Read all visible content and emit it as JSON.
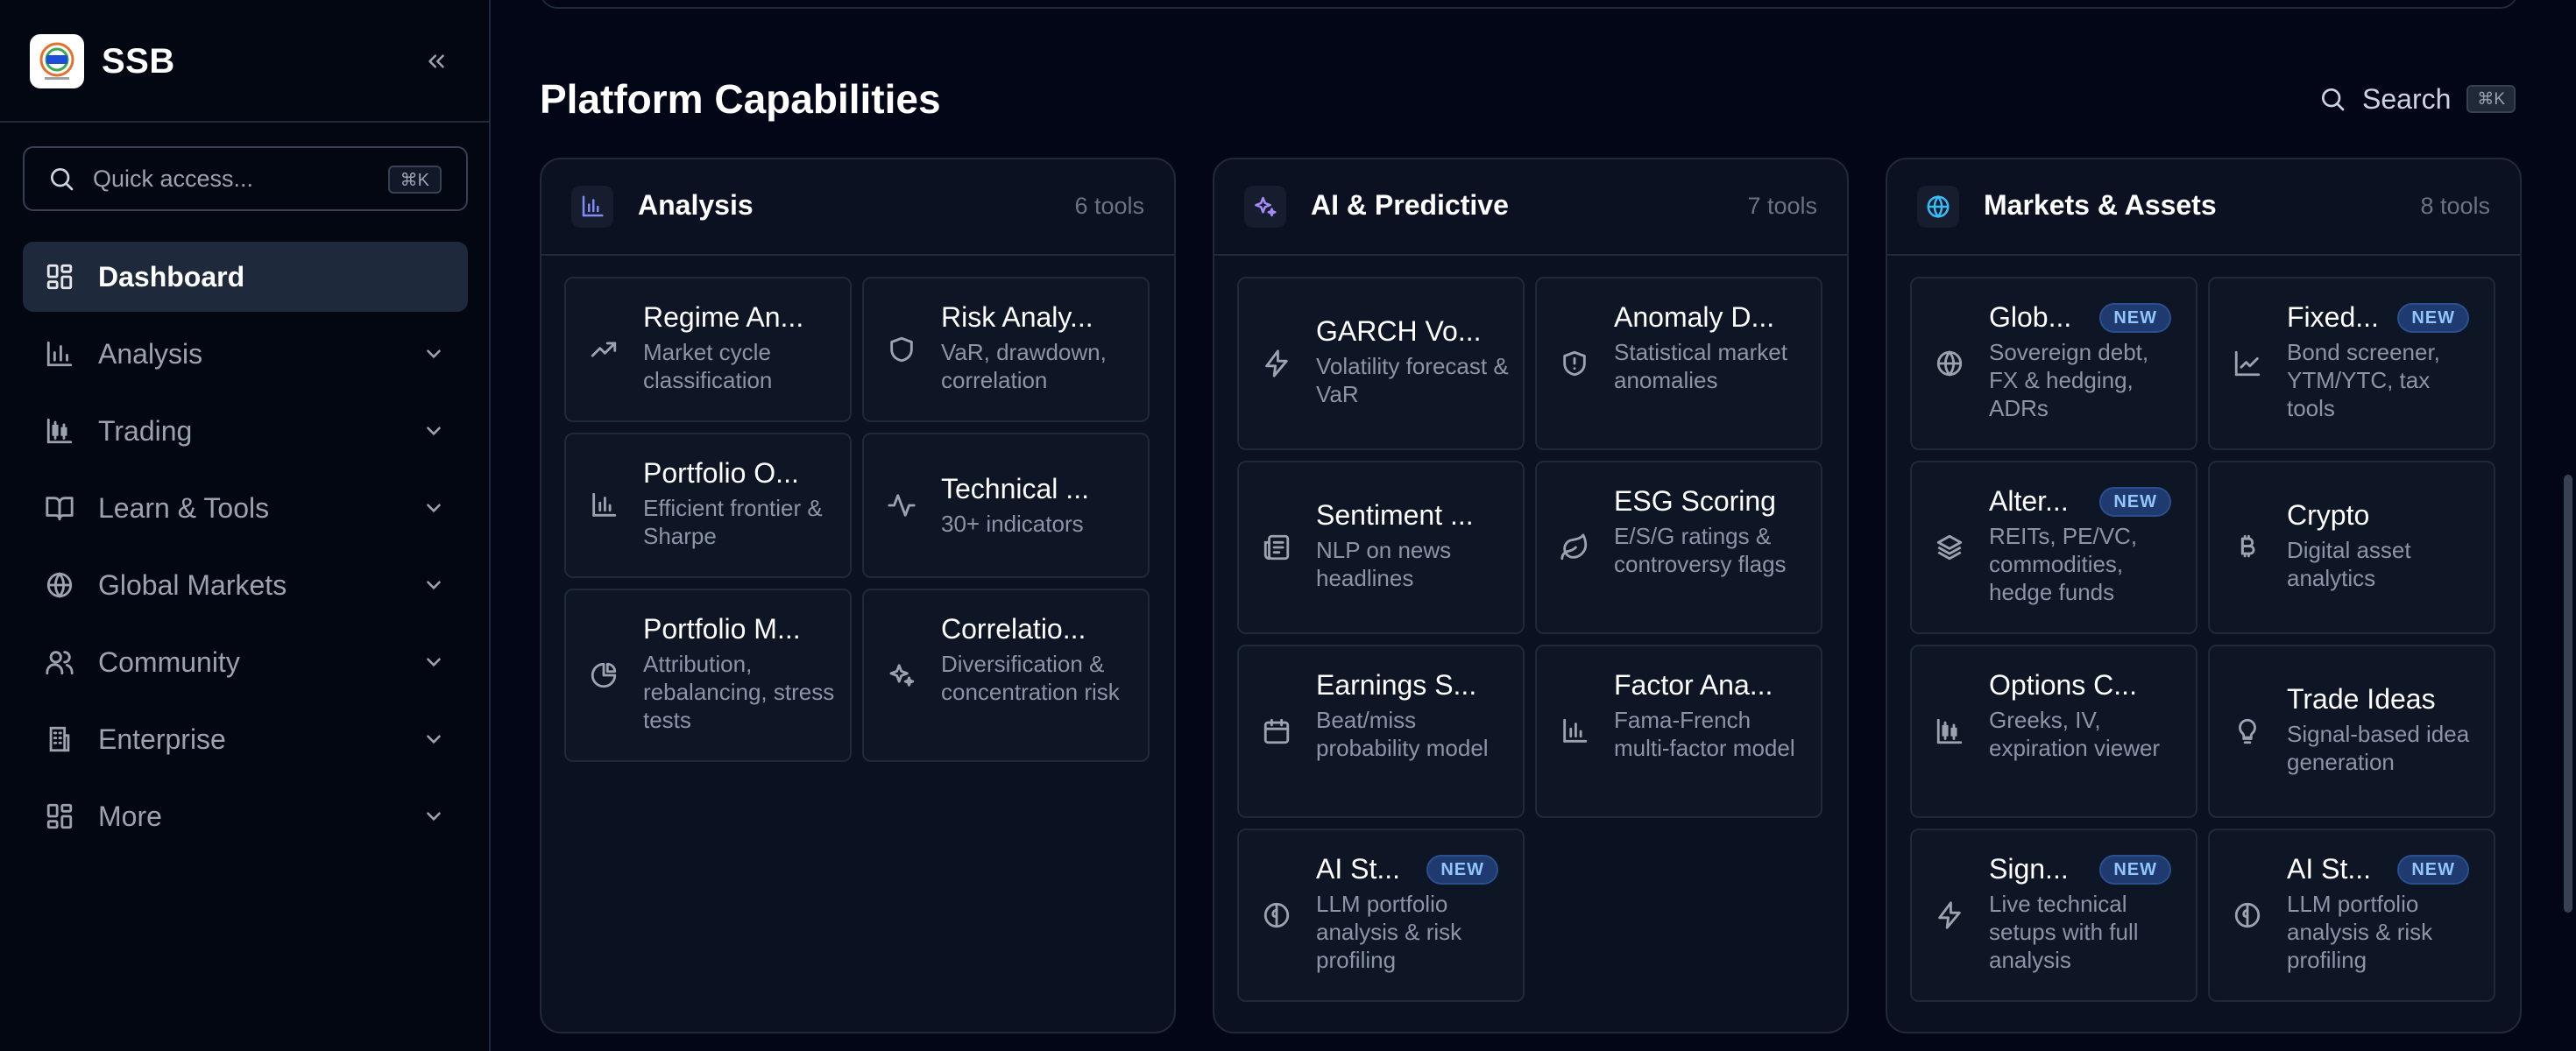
{
  "app": {
    "name": "SSB"
  },
  "sidebar": {
    "search": {
      "placeholder": "Quick access...",
      "shortcut": "⌘K"
    },
    "items": [
      {
        "label": "Dashboard",
        "icon": "dashboard-icon",
        "active": true
      },
      {
        "label": "Analysis",
        "icon": "bar-chart-icon"
      },
      {
        "label": "Trading",
        "icon": "candlestick-icon"
      },
      {
        "label": "Learn & Tools",
        "icon": "book-icon"
      },
      {
        "label": "Global Markets",
        "icon": "globe-icon"
      },
      {
        "label": "Community",
        "icon": "users-icon"
      },
      {
        "label": "Enterprise",
        "icon": "building-icon"
      },
      {
        "label": "More",
        "icon": "grid-icon"
      }
    ]
  },
  "main": {
    "title": "Platform Capabilities",
    "search": {
      "label": "Search",
      "shortcut": "⌘K"
    },
    "panels": [
      {
        "title": "Analysis",
        "count": "6 tools",
        "icon": "bar-chart-icon",
        "tools": [
          {
            "title": "Regime An...",
            "desc": "Market cycle classification",
            "icon": "trending-up-icon"
          },
          {
            "title": "Risk Analy...",
            "desc": "VaR, drawdown, correlation",
            "icon": "shield-icon"
          },
          {
            "title": "Portfolio O...",
            "desc": "Efficient frontier & Sharpe",
            "icon": "bar-chart-icon"
          },
          {
            "title": "Technical ...",
            "desc": "30+ indicators",
            "icon": "activity-icon"
          },
          {
            "title": "Portfolio M...",
            "desc": "Attribution, rebalancing, stress tests",
            "icon": "pie-chart-icon"
          },
          {
            "title": "Correlatio...",
            "desc": "Diversification & concentration risk",
            "icon": "sparkles-icon"
          }
        ]
      },
      {
        "title": "AI & Predictive",
        "count": "7 tools",
        "icon": "sparkles-icon",
        "tools": [
          {
            "title": "GARCH Vo...",
            "desc": "Volatility forecast & VaR",
            "icon": "lightning-icon"
          },
          {
            "title": "Anomaly D...",
            "desc": "Statistical market anomalies",
            "icon": "shield-alert-icon"
          },
          {
            "title": "Sentiment ...",
            "desc": "NLP on news headlines",
            "icon": "newspaper-icon"
          },
          {
            "title": "ESG Scoring",
            "desc": "E/S/G ratings & controversy flags",
            "icon": "leaf-icon"
          },
          {
            "title": "Earnings S...",
            "desc": "Beat/miss probability model",
            "icon": "calendar-icon"
          },
          {
            "title": "Factor Ana...",
            "desc": "Fama-French multi-factor model",
            "icon": "bar-chart-icon"
          },
          {
            "title": "AI St...",
            "desc": "LLM portfolio analysis & risk profiling",
            "icon": "brain-icon",
            "badge": "NEW"
          }
        ]
      },
      {
        "title": "Markets & Assets",
        "count": "8 tools",
        "icon": "globe-icon",
        "tools": [
          {
            "title": "Glob...",
            "desc": "Sovereign debt, FX & hedging, ADRs",
            "icon": "globe-icon",
            "badge": "NEW"
          },
          {
            "title": "Fixed...",
            "desc": "Bond screener, YTM/YTC, tax tools",
            "icon": "line-chart-icon",
            "badge": "NEW"
          },
          {
            "title": "Alter...",
            "desc": "REITs, PE/VC, commodities, hedge funds",
            "icon": "layers-icon",
            "badge": "NEW"
          },
          {
            "title": "Crypto",
            "desc": "Digital asset analytics",
            "icon": "bitcoin-icon"
          },
          {
            "title": "Options C...",
            "desc": "Greeks, IV, expiration viewer",
            "icon": "candlestick-icon"
          },
          {
            "title": "Trade Ideas",
            "desc": "Signal-based idea generation",
            "icon": "lightbulb-icon"
          },
          {
            "title": "Sign...",
            "desc": "Live technical setups with full analysis",
            "icon": "lightning-icon",
            "badge": "NEW"
          },
          {
            "title": "AI St...",
            "desc": "LLM portfolio analysis & risk profiling",
            "icon": "brain-icon",
            "badge": "NEW"
          }
        ]
      }
    ]
  },
  "colors": {
    "accent": "#6366f1",
    "ai_accent": "#a78bfa",
    "globe_accent": "#38bdf8",
    "badge": "#93c5fd"
  }
}
